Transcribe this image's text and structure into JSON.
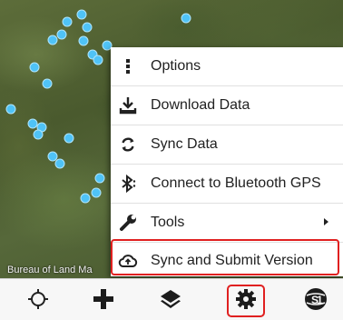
{
  "map": {
    "attribution": "Bureau of Land Ma",
    "marker_color": "#4fc3f7"
  },
  "menu": {
    "items": [
      {
        "label": "Options",
        "icon": "vertical-dots-icon"
      },
      {
        "label": "Download Data",
        "icon": "download-tray-icon"
      },
      {
        "label": "Sync Data",
        "icon": "sync-arrows-icon"
      },
      {
        "label": "Connect to Bluetooth GPS",
        "icon": "bluetooth-icon"
      },
      {
        "label": "Tools",
        "icon": "wrench-icon",
        "has_submenu": true
      },
      {
        "label": "Sync and Submit Version",
        "icon": "cloud-upload-icon",
        "highlighted": true
      }
    ]
  },
  "toolbar": {
    "buttons": [
      {
        "name": "locate",
        "icon": "crosshair-icon"
      },
      {
        "name": "add",
        "icon": "plus-icon"
      },
      {
        "name": "layers",
        "icon": "layers-icon"
      },
      {
        "name": "settings",
        "icon": "gear-icon",
        "highlighted": true
      },
      {
        "name": "app-logo",
        "icon": "globe-logo-icon"
      }
    ]
  },
  "colors": {
    "highlight": "#e02020",
    "marker": "#4fc3f7",
    "menu_text": "#212121"
  }
}
